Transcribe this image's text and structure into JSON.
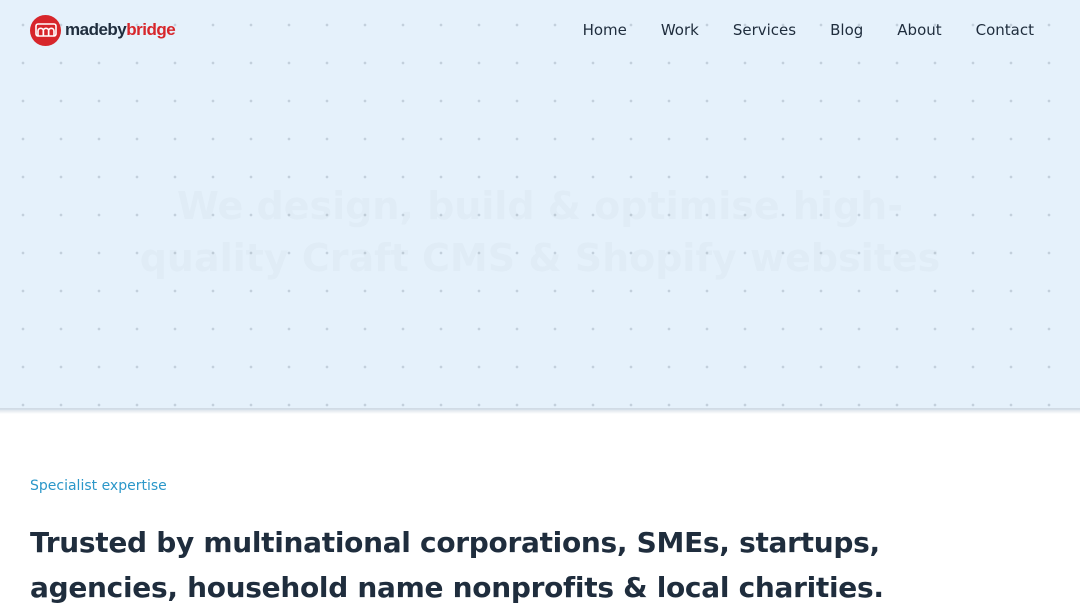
{
  "brand": {
    "made": "made",
    "by": "by",
    "bridge": "bridge",
    "logo_color": "#d7262b"
  },
  "nav": {
    "home": "Home",
    "work": "Work",
    "services": "Services",
    "blog": "Blog",
    "about": "About",
    "contact": "Contact"
  },
  "hero": {
    "title": "We design, build & optimise high-quality Craft CMS & Shopify websites",
    "subtitle": "",
    "cta": ""
  },
  "section": {
    "eyebrow": "Specialist expertise",
    "headline": "Trusted by multinational corporations, SMEs, startups, agencies, household name nonprofits & local charities."
  },
  "colors": {
    "accent": "#2b97c9",
    "text": "#1f2d3d",
    "hero_bg": "#e5f1fb"
  }
}
